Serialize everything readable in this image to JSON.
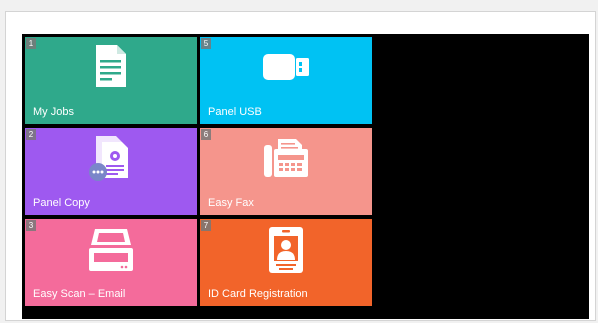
{
  "tiles": [
    {
      "number": "1",
      "label": "My Jobs",
      "color": "#2fa98b",
      "icon": "document-icon"
    },
    {
      "number": "2",
      "label": "Panel Copy",
      "color": "#9e59f0",
      "icon": "copy-icon"
    },
    {
      "number": "3",
      "label": "Easy Scan – Email",
      "color": "#f46b9b",
      "icon": "scanner-icon"
    },
    {
      "number": "5",
      "label": "Panel USB",
      "color": "#00c2f3",
      "icon": "usb-icon"
    },
    {
      "number": "6",
      "label": "Easy Fax",
      "color": "#f5958c",
      "icon": "fax-icon"
    },
    {
      "number": "7",
      "label": "ID Card Registration",
      "color": "#f2642a",
      "icon": "id-card-icon"
    }
  ]
}
